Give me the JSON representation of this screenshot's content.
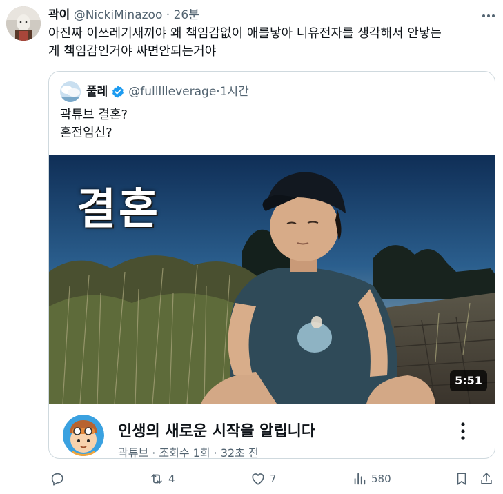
{
  "tweet": {
    "author_name": "곽이",
    "handle": "@NickiMinazoo",
    "separator": "·",
    "time": "26분",
    "text_line1": "아진짜 이쓰레기새끼야 왜 책임감없이 애를낳아 니유전자를 생각해서 안낳는",
    "text_line2": "게 책임감인거야 싸면안되는거야",
    "avatar_icon": "profile-photo",
    "more_icon": "more-dots-icon"
  },
  "quote": {
    "author_name": "풀레",
    "handle": "@fullllleverage",
    "separator": "·",
    "time": "1시간",
    "verified_icon": "verified-badge-icon",
    "verified_color": "#1d9bf0",
    "text_line1": "곽튜브 결혼?",
    "text_line2": "혼전임신?"
  },
  "video": {
    "overlay_text": "결혼",
    "duration": "5:51",
    "channel_avatar": "channel-cartoon-avatar",
    "title": "인생의 새로운 시작을 알립니다",
    "meta": "곽튜브 · 조회수 1회 · 32초 전"
  },
  "actions": {
    "reply_icon": "reply-icon",
    "retweet_icon": "retweet-icon",
    "retweet_count": "4",
    "like_icon": "heart-icon",
    "like_count": "7",
    "views_icon": "views-bar-icon",
    "views_count": "580",
    "bookmark_icon": "bookmark-icon",
    "share_icon": "share-icon"
  },
  "colors": {
    "text": "#0f1419",
    "secondary": "#536471",
    "border": "#cfd9de",
    "accent": "#1d9bf0"
  }
}
